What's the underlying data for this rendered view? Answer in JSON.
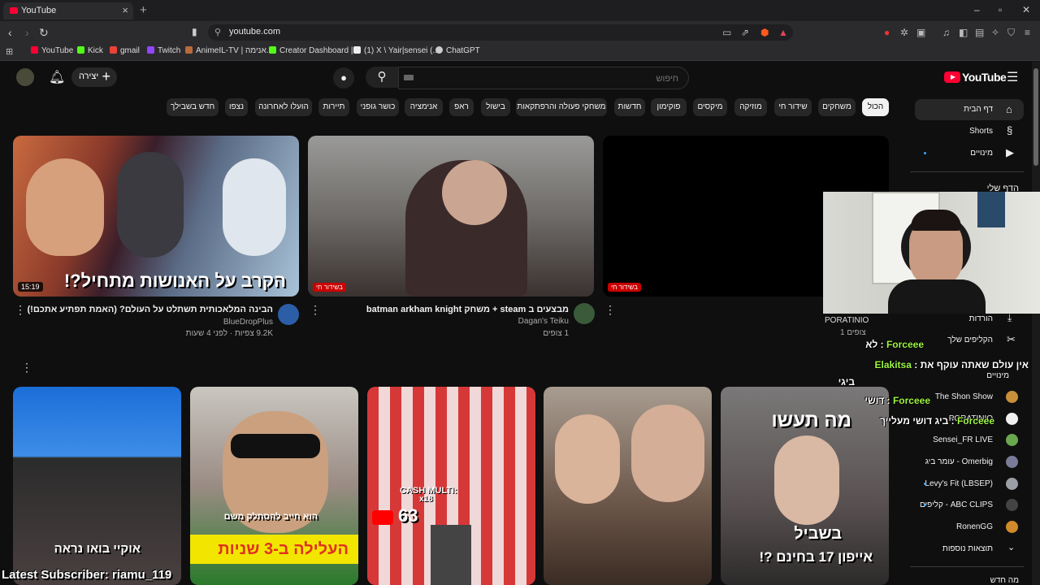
{
  "browser": {
    "tab_title": "YouTube",
    "url": "youtube.com",
    "bookmarks": [
      {
        "label": "YouTube",
        "color": "#ff0033"
      },
      {
        "label": "Kick",
        "color": "#53fc18"
      },
      {
        "label": "gmail",
        "color": "#ea4335"
      },
      {
        "label": "Twitch",
        "color": "#9146ff"
      },
      {
        "label": "AnimeIL-TV | אנימה...",
        "color": "#b86b3a"
      },
      {
        "label": "Creator Dashboard |...",
        "color": "#53fc18"
      },
      {
        "label": "(1) X \\ Yair|sensei (...",
        "color": "#ffffff"
      },
      {
        "label": "ChatGPT",
        "color": "#cccccc"
      }
    ]
  },
  "masthead": {
    "logo_text": "YouTube",
    "create_label": "יצירה",
    "search_placeholder": "חיפוש"
  },
  "chips": [
    "הכול",
    "משחקים",
    "שידור חי",
    "מוזיקה",
    "מיקסים",
    "פוקימון",
    "חדשות",
    "משחקי פעולה והרפתקאות",
    "בישול",
    "ראפ",
    "אנימציה",
    "כושר גופני",
    "תיירות",
    "הועלו לאחרונה",
    "נצפו",
    "חדש בשבילך"
  ],
  "videos": [
    {
      "duration": "15:19",
      "thumb_text": "הקרב על האנושות מתחיל?!",
      "title": "הבינה המלאכותית תשתלט על העולם? (האמת תפתיע אתכם!)",
      "channel": "BlueDropPlus",
      "meta": "9.2K צפיות · לפני 4 שעות"
    },
    {
      "live_badge": "בשידור חי",
      "title": "מבצעים ב steam + משחק batman arkham knight",
      "channel": "Dagan's Teiku",
      "meta": "1 צופים"
    },
    {
      "live_badge": "בשידור חי"
    }
  ],
  "shorts": [
    {
      "text": "אוקיי בואו נראה"
    },
    {
      "text_top": "הוא חייב להסתלק משם",
      "text_bottom": "העלילה ב-3 שניות"
    },
    {
      "text_top": "CASH MULTI:",
      "text_mid": "x18",
      "text_bottom": "63"
    },
    {},
    {
      "text_top": "מה תעשו",
      "text_mid": "בשביל",
      "text_bottom": "אייפון 17 בחינם ?!"
    }
  ],
  "sidebar": {
    "items": [
      {
        "label": "דף הבית",
        "icon": "home-icon"
      },
      {
        "label": "Shorts",
        "icon": "shorts-icon"
      },
      {
        "label": "מינויים",
        "icon": "subscriptions-icon"
      }
    ],
    "you_header": "הדף שלי",
    "downloads": "הורדות",
    "clips": "הקליפים שלך",
    "subs_header": "מינויים",
    "subscriptions": [
      {
        "label": "The Shon Show",
        "color": "#c98f3a"
      },
      {
        "label": "PORATINIO",
        "color": "#f0f0f0"
      },
      {
        "label": "Sensei_FR LIVE",
        "color": "#6aa84f"
      },
      {
        "label": "Omerbig - עומר ביג",
        "color": "#7a7a9a"
      },
      {
        "label": "Levy's Fit (LBSEP)",
        "color": "#9aa0a6"
      },
      {
        "label": "ABC CLIPS - קליפים",
        "color": "#444444"
      },
      {
        "label": "RonenGG",
        "color": "#d08a2a"
      }
    ],
    "show_more": "תוצאות נוספות",
    "bottom_label": "מה חדש"
  },
  "overlay": {
    "chat_channel": "PORATINIO",
    "chat_line_count": "1 צופים",
    "chat": [
      {
        "user": "Forceee",
        "text": "לא"
      },
      {
        "user": "Elakitsa",
        "text": "אין עולם שאתה עוקף את"
      },
      {
        "user": "",
        "text": "ביגי"
      },
      {
        "user": "Forceee",
        "text": "דושי"
      },
      {
        "user": "Forceee",
        "text": "ביג דושי מעלייך"
      }
    ],
    "latest_sub": "Latest Subscriber: riamu_119"
  }
}
